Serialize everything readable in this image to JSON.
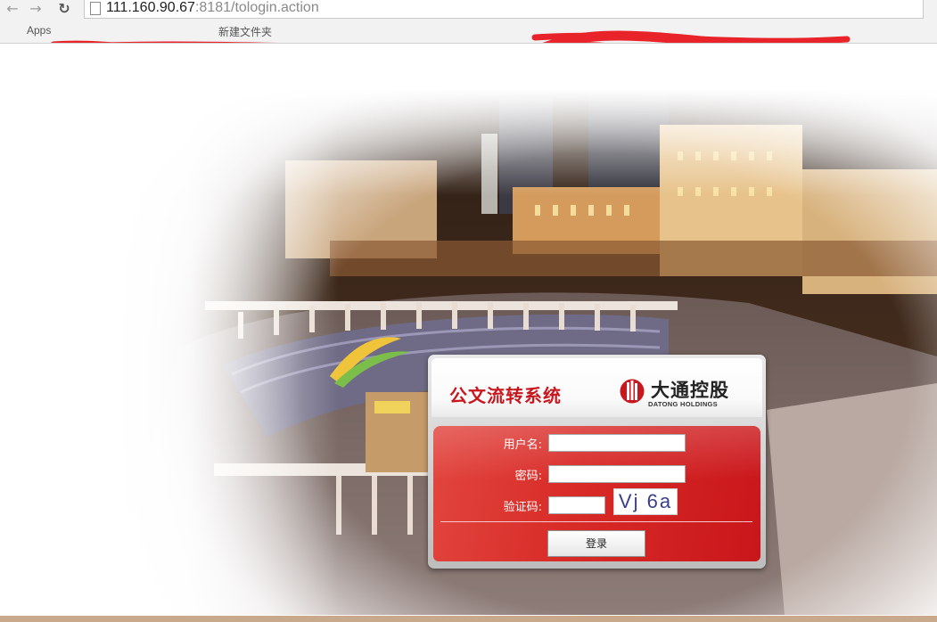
{
  "browser": {
    "url_host": "111.160.90.67",
    "url_path": ":8181/tologin.action",
    "bookmarks": [
      "Apps",
      "新建文件夹"
    ]
  },
  "login": {
    "system_title": "公文流转系统",
    "brand_cn": "大通控股",
    "brand_en": "DATONG HOLDINGS",
    "username_label": "用户名:",
    "username_value": "",
    "password_label": "密码:",
    "password_value": "",
    "captcha_label": "验证码:",
    "captcha_value": "",
    "captcha_text": "Vj 6a",
    "submit_label": "登录"
  },
  "colors": {
    "accent_red": "#c8171e",
    "form_red": "#d82a27"
  },
  "icons": [
    "back-arrow-icon",
    "forward-arrow-icon",
    "reload-icon",
    "page-icon",
    "datong-logo-icon"
  ]
}
